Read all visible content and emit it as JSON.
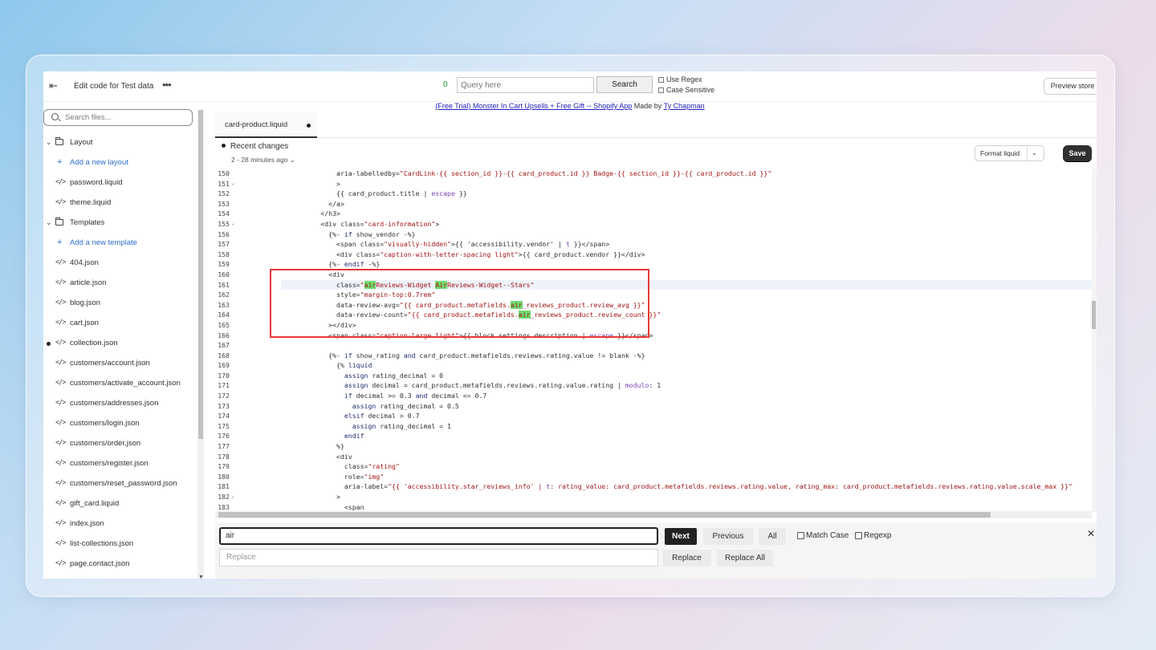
{
  "header": {
    "title": "Edit code for Test data",
    "match_count": "0",
    "query_placeholder": "Query here",
    "search_label": "Search",
    "use_regex_label": "Use Regex",
    "case_sensitive_label": "Case Sensitive",
    "preview_label": "Preview store"
  },
  "promo": {
    "link_text": "(Free Trial) Monster In Cart Upsells + Free Gift -- Shopify App",
    "made_by": " Made by ",
    "author": "Ty Chapman"
  },
  "sidebar": {
    "search_placeholder": "Search files...",
    "items": [
      {
        "type": "folder",
        "label": "Layout"
      },
      {
        "type": "add",
        "label": "Add a new layout"
      },
      {
        "type": "file",
        "label": "password.liquid"
      },
      {
        "type": "file",
        "label": "theme.liquid"
      },
      {
        "type": "folder",
        "label": "Templates"
      },
      {
        "type": "add",
        "label": "Add a new template"
      },
      {
        "type": "file",
        "label": "404.json"
      },
      {
        "type": "file",
        "label": "article.json"
      },
      {
        "type": "file",
        "label": "blog.json"
      },
      {
        "type": "file",
        "label": "cart.json"
      },
      {
        "type": "file",
        "label": "collection.json",
        "modified": true
      },
      {
        "type": "file",
        "label": "customers/account.json"
      },
      {
        "type": "file",
        "label": "customers/activate_account.json"
      },
      {
        "type": "file",
        "label": "customers/addresses.json"
      },
      {
        "type": "file",
        "label": "customers/login.json"
      },
      {
        "type": "file",
        "label": "customers/order.json"
      },
      {
        "type": "file",
        "label": "customers/register.json"
      },
      {
        "type": "file",
        "label": "customers/reset_password.json"
      },
      {
        "type": "file",
        "label": "gift_card.liquid"
      },
      {
        "type": "file",
        "label": "index.json"
      },
      {
        "type": "file",
        "label": "list-collections.json"
      },
      {
        "type": "file",
        "label": "page.contact.json"
      }
    ]
  },
  "editor": {
    "tab_label": "card-product.liquid",
    "recent_changes": "Recent changes",
    "recent_sub": "2 - 28 minutes ago",
    "format_label": "Format liquid",
    "save_label": "Save",
    "code": [
      {
        "n": "150",
        "t": "              aria-labelledby=\"CardLink-{{ section_id }}-{{ card_product.id }} Badge-{{ section_id }}-{{ card_product.id }}\""
      },
      {
        "n": "151",
        "t": "              >",
        "fold": true
      },
      {
        "n": "152",
        "t": "              {{ card_product.title | escape }}"
      },
      {
        "n": "153",
        "t": "            </a>"
      },
      {
        "n": "154",
        "t": "          </h3>"
      },
      {
        "n": "155",
        "t": "          <div class=\"card-information\">",
        "fold": true
      },
      {
        "n": "156",
        "t": "            {%- if show_vendor -%}"
      },
      {
        "n": "157",
        "t": "              <span class=\"visually-hidden\">{{ 'accessibility.vendor' | t }}</span>"
      },
      {
        "n": "158",
        "t": "              <div class=\"caption-with-letter-spacing light\">{{ card_product.vendor }}</div>"
      },
      {
        "n": "159",
        "t": "            {%- endif -%}"
      },
      {
        "n": "160",
        "t": "            <div"
      },
      {
        "n": "161",
        "t": "              class=\"airReviews-Widget AirReviews-Widget--Stars\"",
        "active": true
      },
      {
        "n": "162",
        "t": "              style=\"margin-top:0.7rem\""
      },
      {
        "n": "163",
        "t": "              data-review-avg=\"{{ card_product.metafields.air_reviews_product.review_avg }}\""
      },
      {
        "n": "164",
        "t": "              data-review-count=\"{{ card_product.metafields.air_reviews_product.review_count }}\""
      },
      {
        "n": "165",
        "t": "            ></div>"
      },
      {
        "n": "166",
        "t": "            <span class=\"caption-large light\">{{ block.settings.description | escape }}</span>"
      },
      {
        "n": "167",
        "t": ""
      },
      {
        "n": "168",
        "t": "            {%- if show_rating and card_product.metafields.reviews.rating.value != blank -%}"
      },
      {
        "n": "169",
        "t": "              {% liquid"
      },
      {
        "n": "170",
        "t": "                assign rating_decimal = 0"
      },
      {
        "n": "171",
        "t": "                assign decimal = card_product.metafields.reviews.rating.value.rating | modulo: 1"
      },
      {
        "n": "172",
        "t": "                if decimal >= 0.3 and decimal <= 0.7"
      },
      {
        "n": "173",
        "t": "                  assign rating_decimal = 0.5"
      },
      {
        "n": "174",
        "t": "                elsif decimal > 0.7"
      },
      {
        "n": "175",
        "t": "                  assign rating_decimal = 1"
      },
      {
        "n": "176",
        "t": "                endif"
      },
      {
        "n": "177",
        "t": "              %}"
      },
      {
        "n": "178",
        "t": "              <div"
      },
      {
        "n": "179",
        "t": "                class=\"rating\""
      },
      {
        "n": "180",
        "t": "                role=\"img\""
      },
      {
        "n": "181",
        "t": "                aria-label=\"{{ 'accessibility.star_reviews_info' | t: rating_value: card_product.metafields.reviews.rating.value, rating_max: card_product.metafields.reviews.rating.value.scale_max }}\""
      },
      {
        "n": "182",
        "t": "              >",
        "fold": true
      },
      {
        "n": "183",
        "t": "                <span"
      }
    ]
  },
  "find": {
    "query": "air",
    "replace_placeholder": "Replace",
    "next_label": "Next",
    "previous_label": "Previous",
    "all_label": "All",
    "match_case_label": "Match Case",
    "regexp_label": "Regexp",
    "replace_label": "Replace",
    "replace_all_label": "Replace All"
  },
  "colors": {
    "match_highlight": "#6fdc6f",
    "annotation_box": "#e53935",
    "link": "#2c6ecb"
  }
}
